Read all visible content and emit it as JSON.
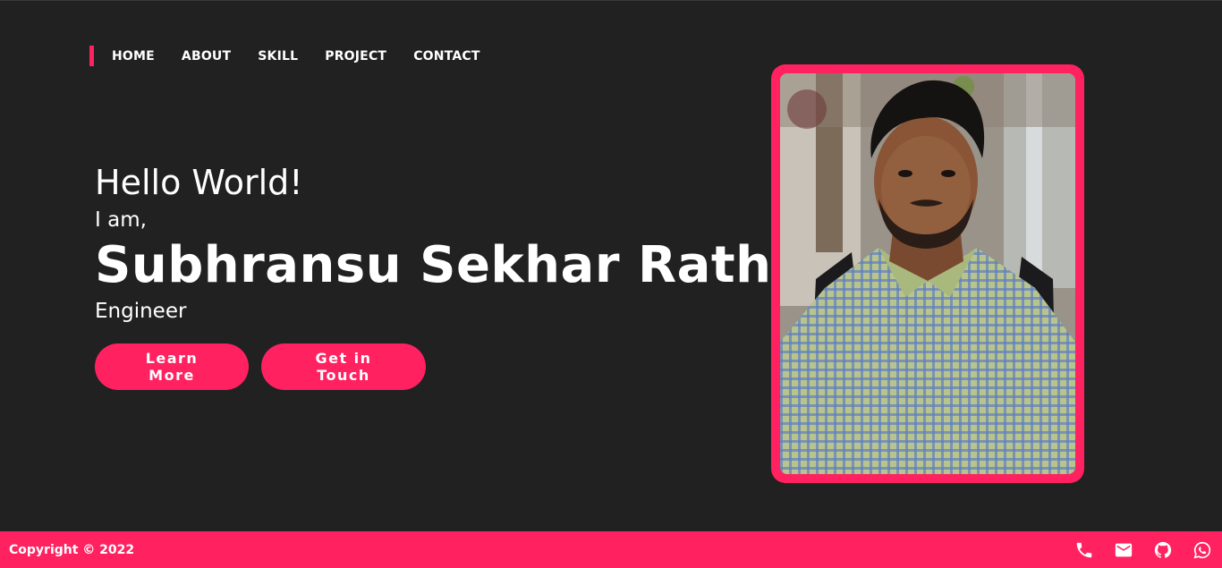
{
  "nav": {
    "items": [
      {
        "label": "HOME"
      },
      {
        "label": "ABOUT"
      },
      {
        "label": "SKILL"
      },
      {
        "label": "PROJECT"
      },
      {
        "label": "CONTACT"
      }
    ]
  },
  "hero": {
    "greeting": "Hello World!",
    "intro": "I am,",
    "name": "Subhransu Sekhar Rath",
    "role": "Engineer",
    "learn_more_label": "Learn More",
    "get_in_touch_label": "Get in Touch"
  },
  "photo": {
    "alt": "Portrait photo"
  },
  "footer": {
    "copyright": "Copyright © 2022",
    "social_icons": [
      "phone-icon",
      "mail-icon",
      "github-icon",
      "whatsapp-icon"
    ]
  },
  "colors": {
    "background": "#212121",
    "accent": "#ff2160",
    "text": "#ffffff"
  }
}
